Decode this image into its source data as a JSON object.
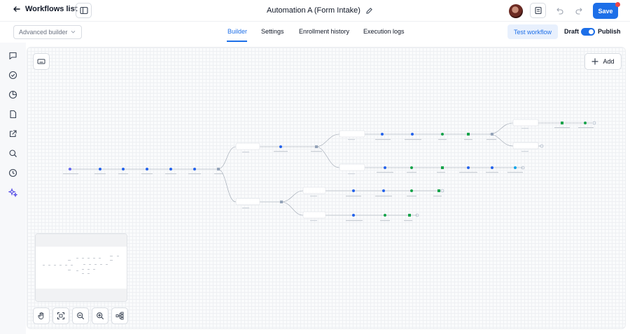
{
  "header": {
    "back_label": "Workflows list",
    "title": "Automation A (Form Intake)",
    "save_label": "Save",
    "accent": "#1d6fe8"
  },
  "subheader": {
    "builder_mode": "Advanced builder",
    "tabs": [
      "Builder",
      "Settings",
      "Enrollment history",
      "Execution logs"
    ],
    "active_tab": "Builder",
    "test_label": "Test workflow",
    "draft_label": "Draft",
    "publish_label": "Publish",
    "publish_toggle_on": true
  },
  "canvas": {
    "add_label": "Add"
  },
  "icons": {
    "rail": [
      "chat-icon",
      "check-circle-icon",
      "pie-chart-icon",
      "file-icon",
      "external-link-icon",
      "search-icon",
      "clock-history-icon",
      "sparkles-icon"
    ],
    "controls": [
      "hand-icon",
      "fit-view-icon",
      "zoom-out-icon",
      "zoom-in-icon",
      "auto-layout-icon"
    ]
  }
}
